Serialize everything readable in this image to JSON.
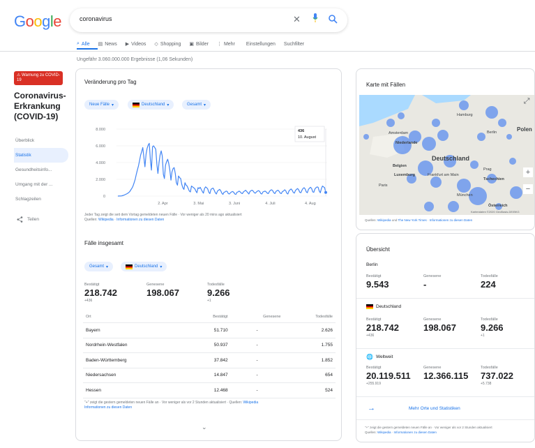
{
  "logo": [
    "G",
    "o",
    "o",
    "g",
    "l",
    "e"
  ],
  "search": {
    "query": "coronavirus",
    "clear_icon": "close-icon",
    "mic_icon": "mic-icon",
    "search_icon": "search-icon"
  },
  "tabs": [
    {
      "label": "Alle",
      "icon": "search-icon"
    },
    {
      "label": "News",
      "icon": "news-icon"
    },
    {
      "label": "Videos",
      "icon": "video-icon"
    },
    {
      "label": "Shopping",
      "icon": "tag-icon"
    },
    {
      "label": "Bilder",
      "icon": "image-icon"
    },
    {
      "label": "Mehr",
      "icon": "more-icon"
    },
    {
      "label": "Einstellungen",
      "icon": ""
    },
    {
      "label": "Suchfilter",
      "icon": ""
    }
  ],
  "results_count": "Ungefähr 3.060.000.000 Ergebnisse (1,06 Sekunden)",
  "sidebar": {
    "warning": "Warnung zu COVID-19",
    "title": "Coronavirus-Erkrankung (COVID-19)",
    "items": [
      "Überblick",
      "Statistik",
      "Gesundheitsinfo...",
      "Umgang mit der ...",
      "Schlagzeilen"
    ],
    "share": "Teilen"
  },
  "daily": {
    "title": "Veränderung pro Tag",
    "chip_new": "Neue Fälle",
    "chip_country": "Deutschland",
    "chip_total": "Gesamt",
    "tooltip_value": "436",
    "tooltip_date": "10. August",
    "footnote": "Jeder Tag zeigt die seit dem Vortag gemeldeten neuen Fälle · Vor weniger als 20 mins ago aktualisiert",
    "source_label": "Quellen:",
    "source_link1": "Wikipedia",
    "source_link2": "Informationen zu diesen Daten"
  },
  "chart_data": {
    "type": "line",
    "yticks": [
      "8.000",
      "6.000",
      "4.000",
      "2.000",
      "0"
    ],
    "xticks": [
      "2. Apr",
      "3. Mai",
      "3. Juni",
      "4. Juli",
      "4. Aug"
    ],
    "ylim": [
      0,
      8000
    ],
    "series": [
      {
        "values": [
          0,
          5,
          10,
          20,
          40,
          80,
          130,
          200,
          250,
          330,
          420,
          550,
          750,
          950,
          1200,
          1600,
          2000,
          2600,
          3100,
          3600,
          4200,
          4900,
          5300,
          5800,
          4600,
          3500,
          5000,
          5700,
          6100,
          6300,
          4300,
          3100,
          5900,
          6000,
          5800,
          5600,
          3800,
          2700,
          4000,
          4900,
          5400,
          4800,
          2600,
          2100,
          3700,
          4100,
          4400,
          3900,
          3100,
          1900,
          2900,
          3300,
          3400,
          2700,
          1600,
          1300,
          2400,
          2200,
          2100,
          1400,
          1000,
          800,
          1600,
          1300,
          1200,
          900,
          600,
          500,
          1200,
          1100,
          1000,
          900,
          600,
          400,
          1000,
          900,
          1050,
          800,
          550,
          350,
          900,
          1100,
          1000,
          850,
          450,
          300,
          800,
          900,
          950,
          700,
          400,
          250,
          600,
          700,
          800,
          650,
          350,
          200,
          450,
          500,
          600,
          550,
          300,
          250,
          400,
          500,
          550,
          450,
          250,
          200,
          450,
          500,
          600,
          500,
          350,
          300,
          500,
          600,
          700,
          550,
          400,
          250,
          550,
          650,
          700,
          600,
          400,
          350,
          500,
          600,
          650,
          550,
          300,
          250,
          500,
          550,
          600,
          500,
          350,
          300,
          550,
          700,
          750,
          650,
          400,
          300,
          550,
          650,
          700,
          550,
          350,
          300,
          550,
          600,
          750,
          650,
          350,
          250,
          600,
          750,
          850,
          700,
          450,
          350,
          650,
          800,
          900,
          750,
          450,
          400,
          700,
          900,
          1000,
          850,
          500,
          400,
          800,
          950,
          1050,
          900,
          500,
          450,
          850,
          1000,
          1100,
          1050,
          600,
          400,
          900,
          1200,
          1100,
          1000,
          436
        ]
      }
    ]
  },
  "total": {
    "title": "Fälle insgesamt",
    "chip_total": "Gesamt",
    "chip_country": "Deutschland",
    "confirmed_label": "Bestätigt",
    "confirmed": "218.742",
    "confirmed_delta": "+436",
    "recovered_label": "Genesene",
    "recovered": "198.067",
    "deaths_label": "Todesfälle",
    "deaths": "9.266",
    "deaths_delta": "+1",
    "table_headers": [
      "Ort",
      "Bestätigt",
      "Genesene",
      "Todesfälle"
    ],
    "rows": [
      [
        "Bayern",
        "51.710",
        "-",
        "2.626"
      ],
      [
        "Nordrhein-Westfalen",
        "50.937",
        "-",
        "1.755"
      ],
      [
        "Baden-Württemberg",
        "37.842",
        "-",
        "1.852"
      ],
      [
        "Niedersachsen",
        "14.847",
        "-",
        "654"
      ],
      [
        "Hessen",
        "12.468",
        "-",
        "524"
      ]
    ],
    "footnote": "\"+\" zeigt die gestern gemeldeten neuen Fälle an · Vor weniger als vor 2 Stunden aktualisiert",
    "source_label": "Quellen:",
    "source_link1": "Wikipedia",
    "source_link2": "Informationen zu diesen Daten"
  },
  "map": {
    "title": "Karte mit Fällen",
    "labels": [
      "Hamburg",
      "Amsterdam",
      "Berlin",
      "Polen",
      "Niederlande",
      "Belgien",
      "Deutschland",
      "Prag",
      "Luxemburg",
      "Frankfurt am Main",
      "Tschechien",
      "Paris",
      "München",
      "Österreich"
    ],
    "footnote_label": "Quellen:",
    "footnote_link1": "Wikipedia",
    "footnote_mid": "und",
    "footnote_link2": "The New York Times",
    "footnote_link3": "Informationen zu diesen Daten",
    "expand_icon": "expand-icon",
    "zoom_in": "+",
    "zoom_out": "−",
    "attribution": "Kartendaten ©2020 GeoBasis-DE/BKG"
  },
  "overview": {
    "title": "Übersicht",
    "regions": [
      {
        "name": "Berlin",
        "confirmed_label": "Bestätigt",
        "confirmed": "9.543",
        "confirmed_delta": "",
        "recovered_label": "Genesene",
        "recovered": "-",
        "deaths_label": "Todesfälle",
        "deaths": "224",
        "deaths_delta": ""
      },
      {
        "name": "Deutschland",
        "confirmed_label": "Bestätigt",
        "confirmed": "218.742",
        "confirmed_delta": "+436",
        "recovered_label": "Genesene",
        "recovered": "198.067",
        "deaths_label": "Todesfälle",
        "deaths": "9.266",
        "deaths_delta": "+1"
      },
      {
        "name": "Weltweit",
        "confirmed_label": "Bestätigt",
        "confirmed": "20.119.511",
        "confirmed_delta": "+255.919",
        "recovered_label": "Genesene",
        "recovered": "12.366.115",
        "deaths_label": "Todesfälle",
        "deaths": "737.022",
        "deaths_delta": "+5.738"
      }
    ],
    "more_label": "Mehr Orte und Statistiken",
    "footnote": "\"+\" zeigt die gestern gemeldeten neuen Fälle an · Vor weniger als vor 2 Stunden aktualisiert",
    "source_label": "Quellen:",
    "source_link1": "Wikipedia",
    "source_link2": "Informationen zu diesen Daten"
  },
  "colors": {
    "accent": "#1a73e8",
    "warning": "#d93025",
    "chart_line": "#4285f4",
    "map_bubble": "#5b8def"
  }
}
